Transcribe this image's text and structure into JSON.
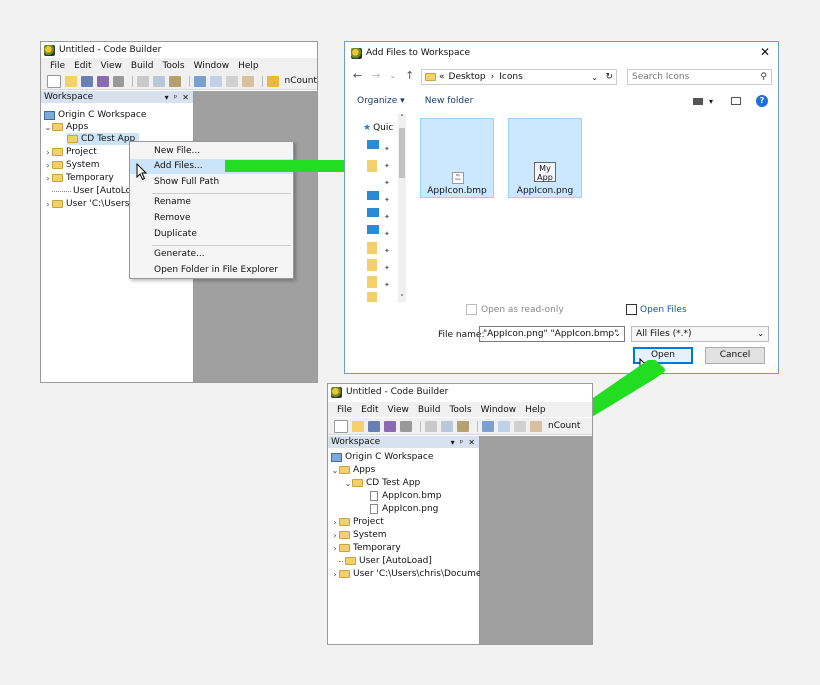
{
  "colors": {
    "arrow": "#22dd22",
    "highlight": "#cce4f7",
    "grey_area": "#a0a0a0",
    "accent": "#0078d7"
  },
  "top_left": {
    "title": "Untitled - Code Builder",
    "menu": [
      "File",
      "Edit",
      "View",
      "Build",
      "Tools",
      "Window",
      "Help"
    ],
    "toolbar_text": "nCount",
    "panel_title": "Workspace",
    "tree": {
      "root": "Origin C Workspace",
      "apps": "Apps",
      "app": "CD Test App",
      "project": "Project",
      "system": "System",
      "temporary": "Temporary",
      "user_autoload": "User [AutoLoa",
      "user_path": "User 'C:\\Users\\"
    },
    "context_menu": [
      "New File...",
      "Add Files...",
      "Show Full Path",
      "Rename",
      "Remove",
      "Duplicate",
      "Generate...",
      "Open Folder in File Explorer"
    ]
  },
  "dialog": {
    "title": "Add Files to Workspace",
    "breadcrumb": [
      "«",
      "Desktop",
      "›",
      "Icons"
    ],
    "search_placeholder": "Search Icons",
    "organize": "Organize ▾",
    "new_folder": "New folder",
    "nav_label": "Quic",
    "files": [
      {
        "name": "AppIcon.bmp",
        "thumb": "My\nApp"
      },
      {
        "name": "AppIcon.png",
        "thumb": "My\nApp"
      }
    ],
    "open_read_only": "Open as read-only",
    "open_files": "Open Files",
    "file_name_label": "File name:",
    "file_name_value": "\"AppIcon.png\" \"AppIcon.bmp\"",
    "filter": "All Files (*.*)",
    "open_button": "Open",
    "cancel_button": "Cancel"
  },
  "bottom": {
    "title": "Untitled - Code Builder",
    "menu": [
      "File",
      "Edit",
      "View",
      "Build",
      "Tools",
      "Window",
      "Help"
    ],
    "toolbar_text": "nCount",
    "panel_title": "Workspace",
    "tree": {
      "root": "Origin C Workspace",
      "apps": "Apps",
      "app": "CD Test App",
      "file1": "AppIcon.bmp",
      "file2": "AppIcon.png",
      "project": "Project",
      "system": "System",
      "temporary": "Temporary",
      "user_autoload": "User [AutoLoad]",
      "user_path": "User 'C:\\Users\\chris\\Documents"
    }
  }
}
